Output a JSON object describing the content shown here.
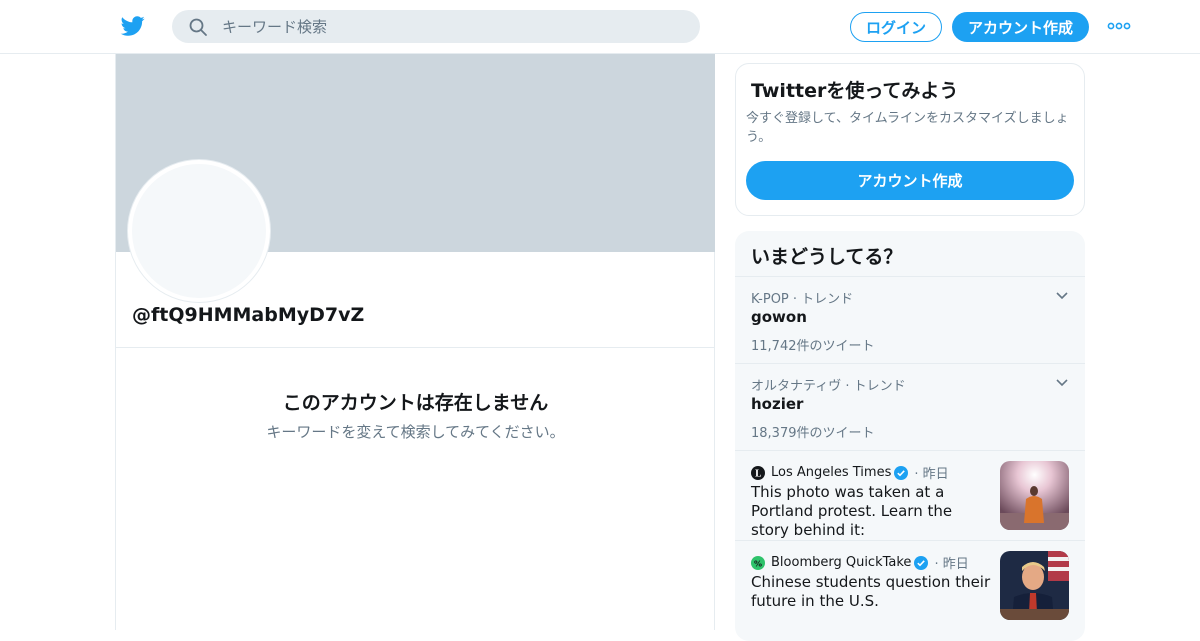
{
  "header": {
    "search_placeholder": "キーワード検索",
    "login_label": "ログイン",
    "signup_label": "アカウント作成"
  },
  "profile": {
    "handle": "@ftQ9HMMabMyD7vZ",
    "empty_title": "このアカウントは存在しません",
    "empty_subtitle": "キーワードを変えて検索してみてください。"
  },
  "signup_card": {
    "title": "Twitterを使ってみよう",
    "description": "今すぐ登録して、タイムラインをカスタマイズしましょう。",
    "button": "アカウント作成"
  },
  "trends": {
    "heading": "いまどうしてる？",
    "items": [
      {
        "meta": "K-POP · トレンド",
        "name": "gowon",
        "count": "11,742件のツイート"
      },
      {
        "meta": "オルタナティヴ · トレンド",
        "name": "hozier",
        "count": "18,379件のツイート"
      }
    ],
    "news": [
      {
        "source": "Los Angeles Times",
        "time": "昨日",
        "headline": "This photo was taken at a Portland protest. Learn the story behind it:"
      },
      {
        "source": "Bloomberg QuickTake",
        "time": "昨日",
        "headline": "Chinese students question their future in the U.S."
      }
    ]
  },
  "colors": {
    "accent": "#1da1f2",
    "banner": "#ccd6dd",
    "muted": "#657786"
  }
}
